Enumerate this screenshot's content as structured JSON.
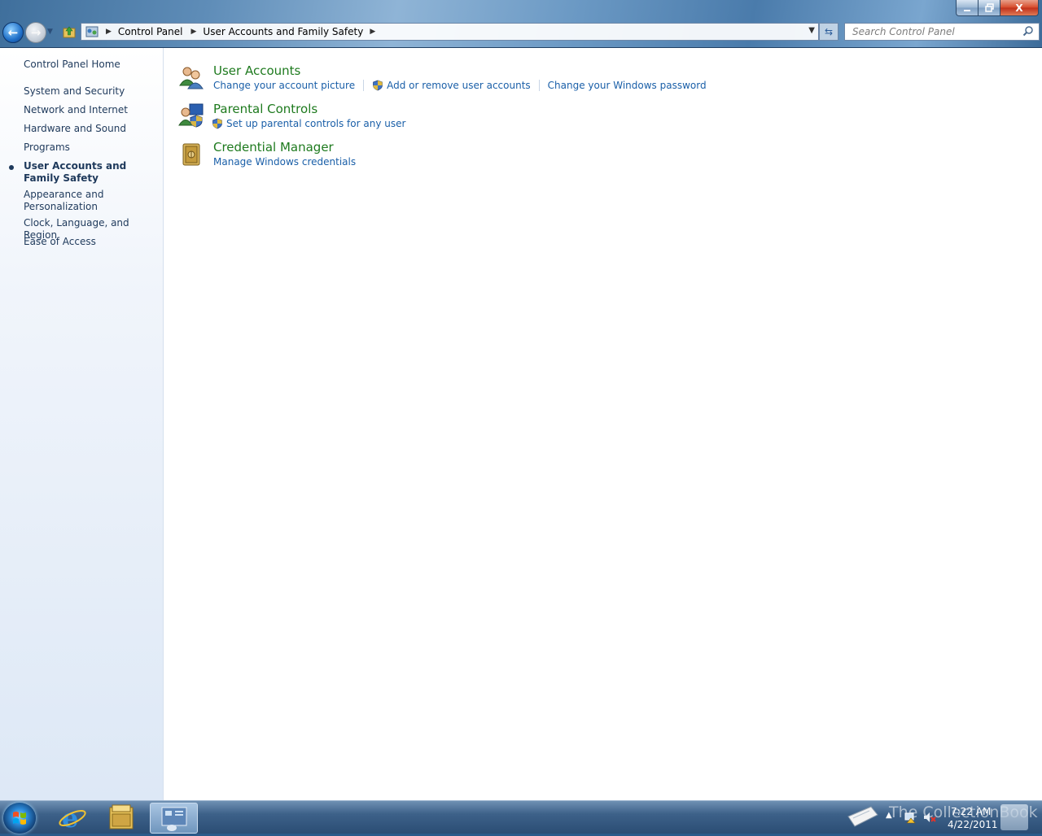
{
  "window": {
    "minimize_icon": "minimize-icon",
    "maximize_icon": "restore-icon",
    "close_label": "X"
  },
  "address": {
    "crumbs": [
      "Control Panel",
      "User Accounts and Family Safety"
    ]
  },
  "search": {
    "placeholder": "Search Control Panel"
  },
  "nav": {
    "items": [
      {
        "label": "Control Panel Home"
      },
      {
        "label": "System and Security"
      },
      {
        "label": "Network and Internet"
      },
      {
        "label": "Hardware and Sound"
      },
      {
        "label": "Programs"
      },
      {
        "label": "User Accounts and Family Safety",
        "current": true
      },
      {
        "label": "Appearance and Personalization"
      },
      {
        "label": "Clock, Language, and Region"
      },
      {
        "label": "Ease of Access"
      }
    ]
  },
  "categories": [
    {
      "title": "User Accounts",
      "icon": "users-icon",
      "tasks": [
        {
          "label": "Change your account picture",
          "shield": false
        },
        {
          "label": "Add or remove user accounts",
          "shield": true
        },
        {
          "label": "Change your Windows password",
          "shield": false
        }
      ]
    },
    {
      "title": "Parental Controls",
      "icon": "parental-controls-icon",
      "tasks": [
        {
          "label": "Set up parental controls for any user",
          "shield": true
        }
      ]
    },
    {
      "title": "Credential Manager",
      "icon": "vault-icon",
      "tasks": [
        {
          "label": "Manage Windows credentials",
          "shield": false
        }
      ]
    }
  ],
  "taskbar": {
    "time": "7:22 AM",
    "date": "4/22/2011",
    "watermark": "The CollectionBook",
    "pinned": [
      "internet-explorer-icon",
      "windows-explorer-icon",
      "control-panel-icon"
    ]
  },
  "colors": {
    "category_title": "#1e7a1e",
    "task_link": "#1a5fa8",
    "nav_text": "#1e395b"
  }
}
